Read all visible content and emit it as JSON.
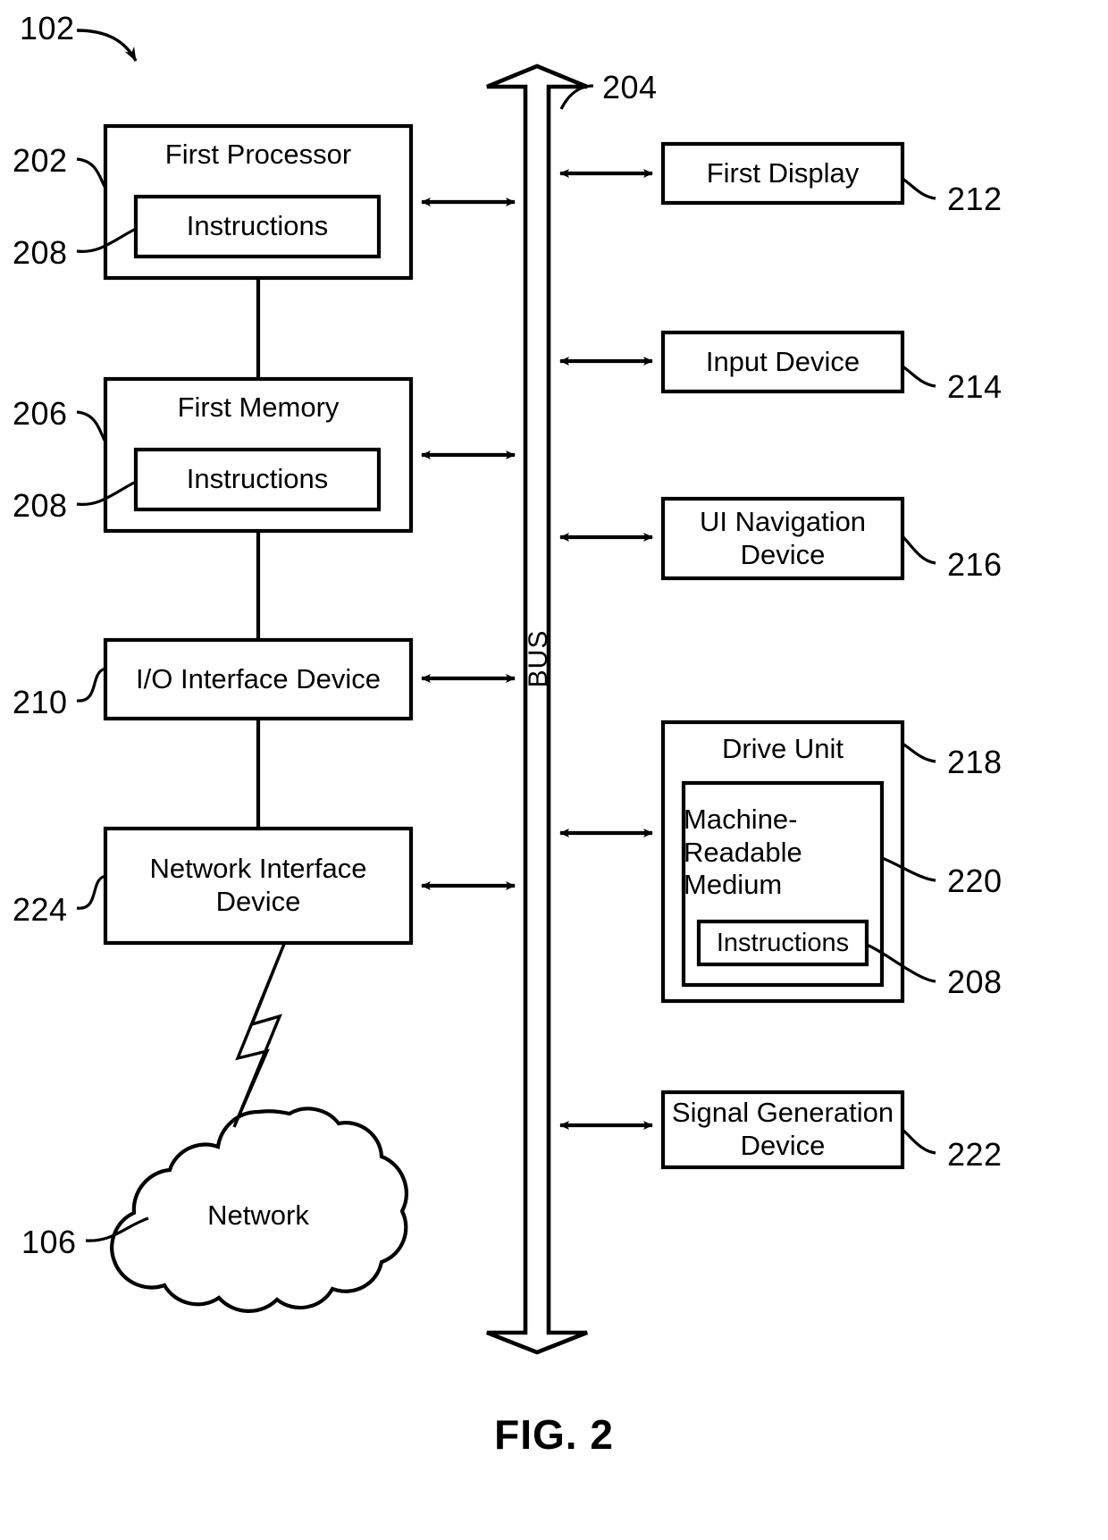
{
  "figure": {
    "caption": "FIG. 2",
    "system_ref": "102",
    "title_hidden": ""
  },
  "bus": {
    "label": "BUS",
    "ref": "204"
  },
  "left_column": {
    "blocks": [
      {
        "id": "first-processor",
        "label": "First Processor",
        "ref": "202",
        "inner": {
          "label": "Instructions",
          "ref": "208"
        }
      },
      {
        "id": "first-memory",
        "label": "First Memory",
        "ref": "206",
        "inner": {
          "label": "Instructions",
          "ref": "208"
        }
      },
      {
        "id": "io-interface-device",
        "label": "I/O Interface Device",
        "ref": "210",
        "inner": null
      },
      {
        "id": "network-interface-device",
        "label": "Network Interface Device",
        "label_line1": "Network Interface",
        "label_line2": "Device",
        "ref": "224",
        "inner": null
      }
    ],
    "network_cloud": {
      "label": "Network",
      "ref": "106",
      "connector": "lightning-bolt"
    }
  },
  "right_column": {
    "blocks": [
      {
        "id": "first-display",
        "label": "First Display",
        "ref": "212"
      },
      {
        "id": "input-device",
        "label": "Input Device",
        "ref": "214"
      },
      {
        "id": "ui-navigation-device",
        "label": "UI Navigation Device",
        "label_line1": "UI Navigation",
        "label_line2": "Device",
        "ref": "216"
      },
      {
        "id": "drive-unit",
        "label": "Drive Unit",
        "ref": "218",
        "inner": {
          "id": "machine-readable-medium",
          "label": "Machine-Readable Medium",
          "label_line1": "Machine-",
          "label_line2": "Readable",
          "label_line3": "Medium",
          "ref": "220",
          "inner": {
            "id": "drive-instructions",
            "label": "Instructions",
            "ref": "208"
          }
        }
      },
      {
        "id": "signal-generation-device",
        "label": "Signal Generation Device",
        "label_line1": "Signal Generation",
        "label_line2": "Device",
        "ref": "222"
      }
    ]
  },
  "colors": {
    "stroke": "#000000",
    "background": "#ffffff"
  }
}
